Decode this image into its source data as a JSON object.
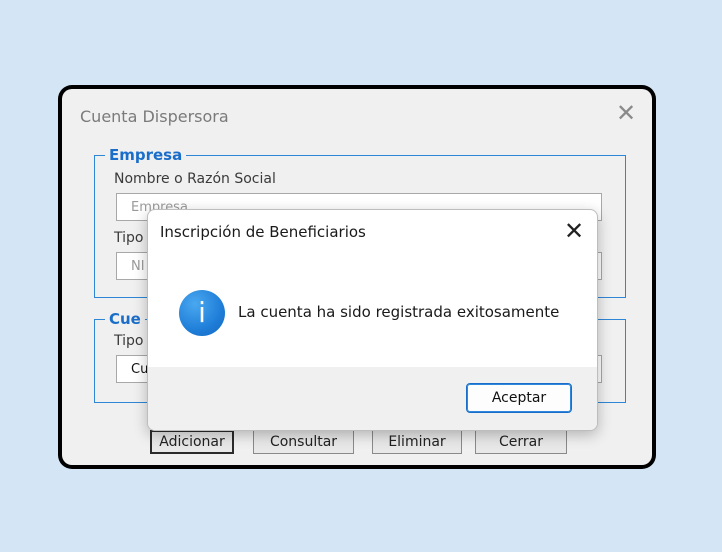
{
  "background_window": {
    "title": "Cuenta Dispersora",
    "close_glyph": "✕",
    "group_empresa": {
      "legend": "Empresa",
      "label_nombre": "Nombre o Razón Social",
      "nombre_placeholder": "Empresa",
      "label_tipo": "Tipo",
      "tipo_value": "NI"
    },
    "group_cuenta": {
      "legend": "Cue",
      "label_tipo": "Tipo",
      "tipo_value": "Cu"
    },
    "buttons": {
      "adicionar": "Adicionar",
      "consultar": "Consultar",
      "eliminar": "Eliminar",
      "cerrar": "Cerrar"
    }
  },
  "dialog": {
    "title": "Inscripción de Beneficiarios",
    "close_glyph": "✕",
    "icon": "info-icon",
    "icon_glyph": "i",
    "message": "La cuenta ha sido registrada exitosamente",
    "ok_label": "Aceptar"
  },
  "colors": {
    "page_bg": "#d4e5f5",
    "accent": "#1a6ec9",
    "info_icon": "#1f7ed8"
  }
}
